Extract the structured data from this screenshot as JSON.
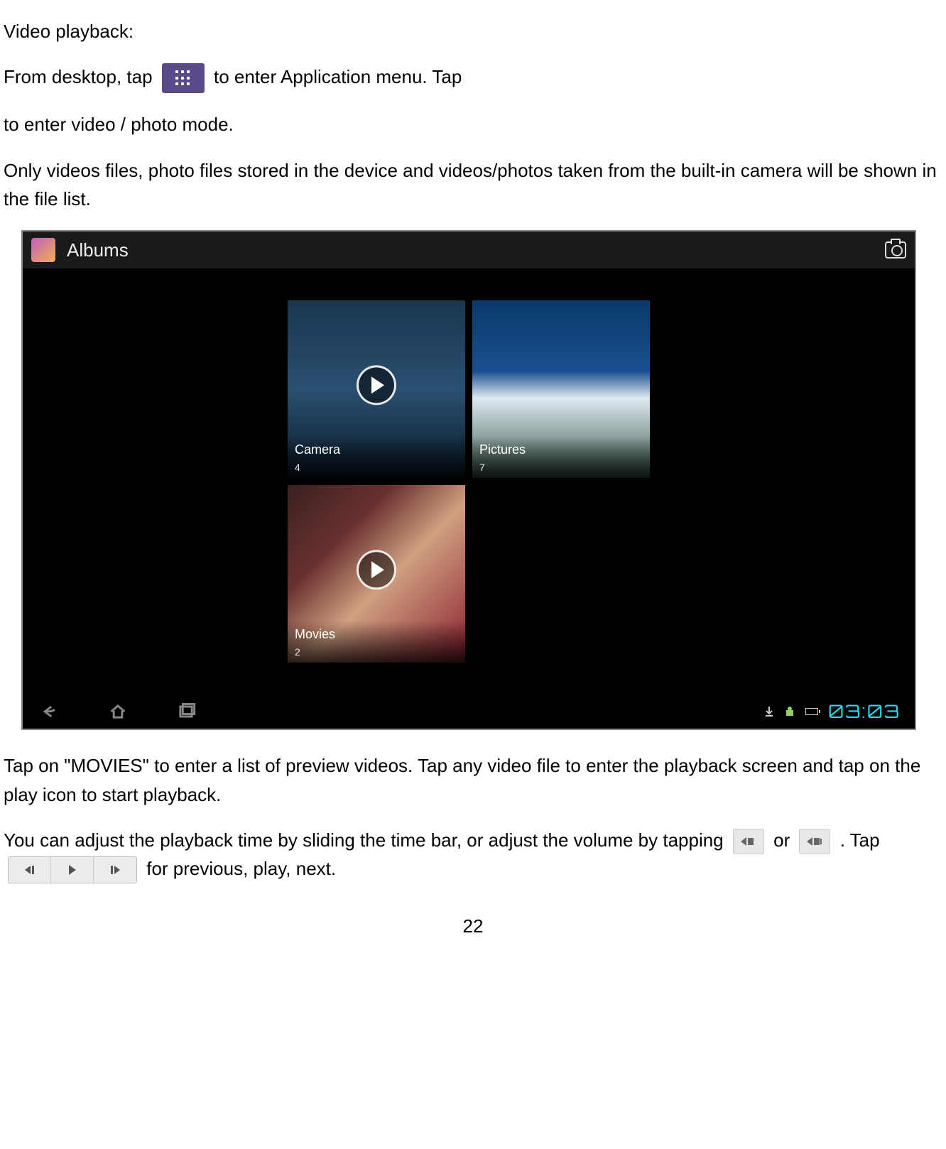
{
  "doc": {
    "heading": "Video playback:",
    "p1_a": "From desktop, tap ",
    "p1_b": " to enter Application menu.   Tap",
    "p2": "to enter video / photo mode.",
    "p3": "Only videos files, photo files stored in the device and videos/photos taken from the built-in camera will be shown in the file list.",
    "p4": "Tap on \"MOVIES\" to enter a list of preview videos.   Tap any video file to enter the playback screen and tap on the play icon to start playback.",
    "p5_a": "You can adjust the playback time by sliding the time bar, or adjust the volume by tapping ",
    "p5_b": " or ",
    "p5_c": ".    Tap ",
    "p5_d": " for previous, play, next.",
    "page_number": "22"
  },
  "screenshot": {
    "title": "Albums",
    "albums": {
      "camera": {
        "label": "Camera",
        "count": "4"
      },
      "pictures": {
        "label": "Pictures",
        "count": "7"
      },
      "movies": {
        "label": "Movies",
        "count": "2"
      }
    },
    "status": {
      "time": "03:03"
    }
  }
}
